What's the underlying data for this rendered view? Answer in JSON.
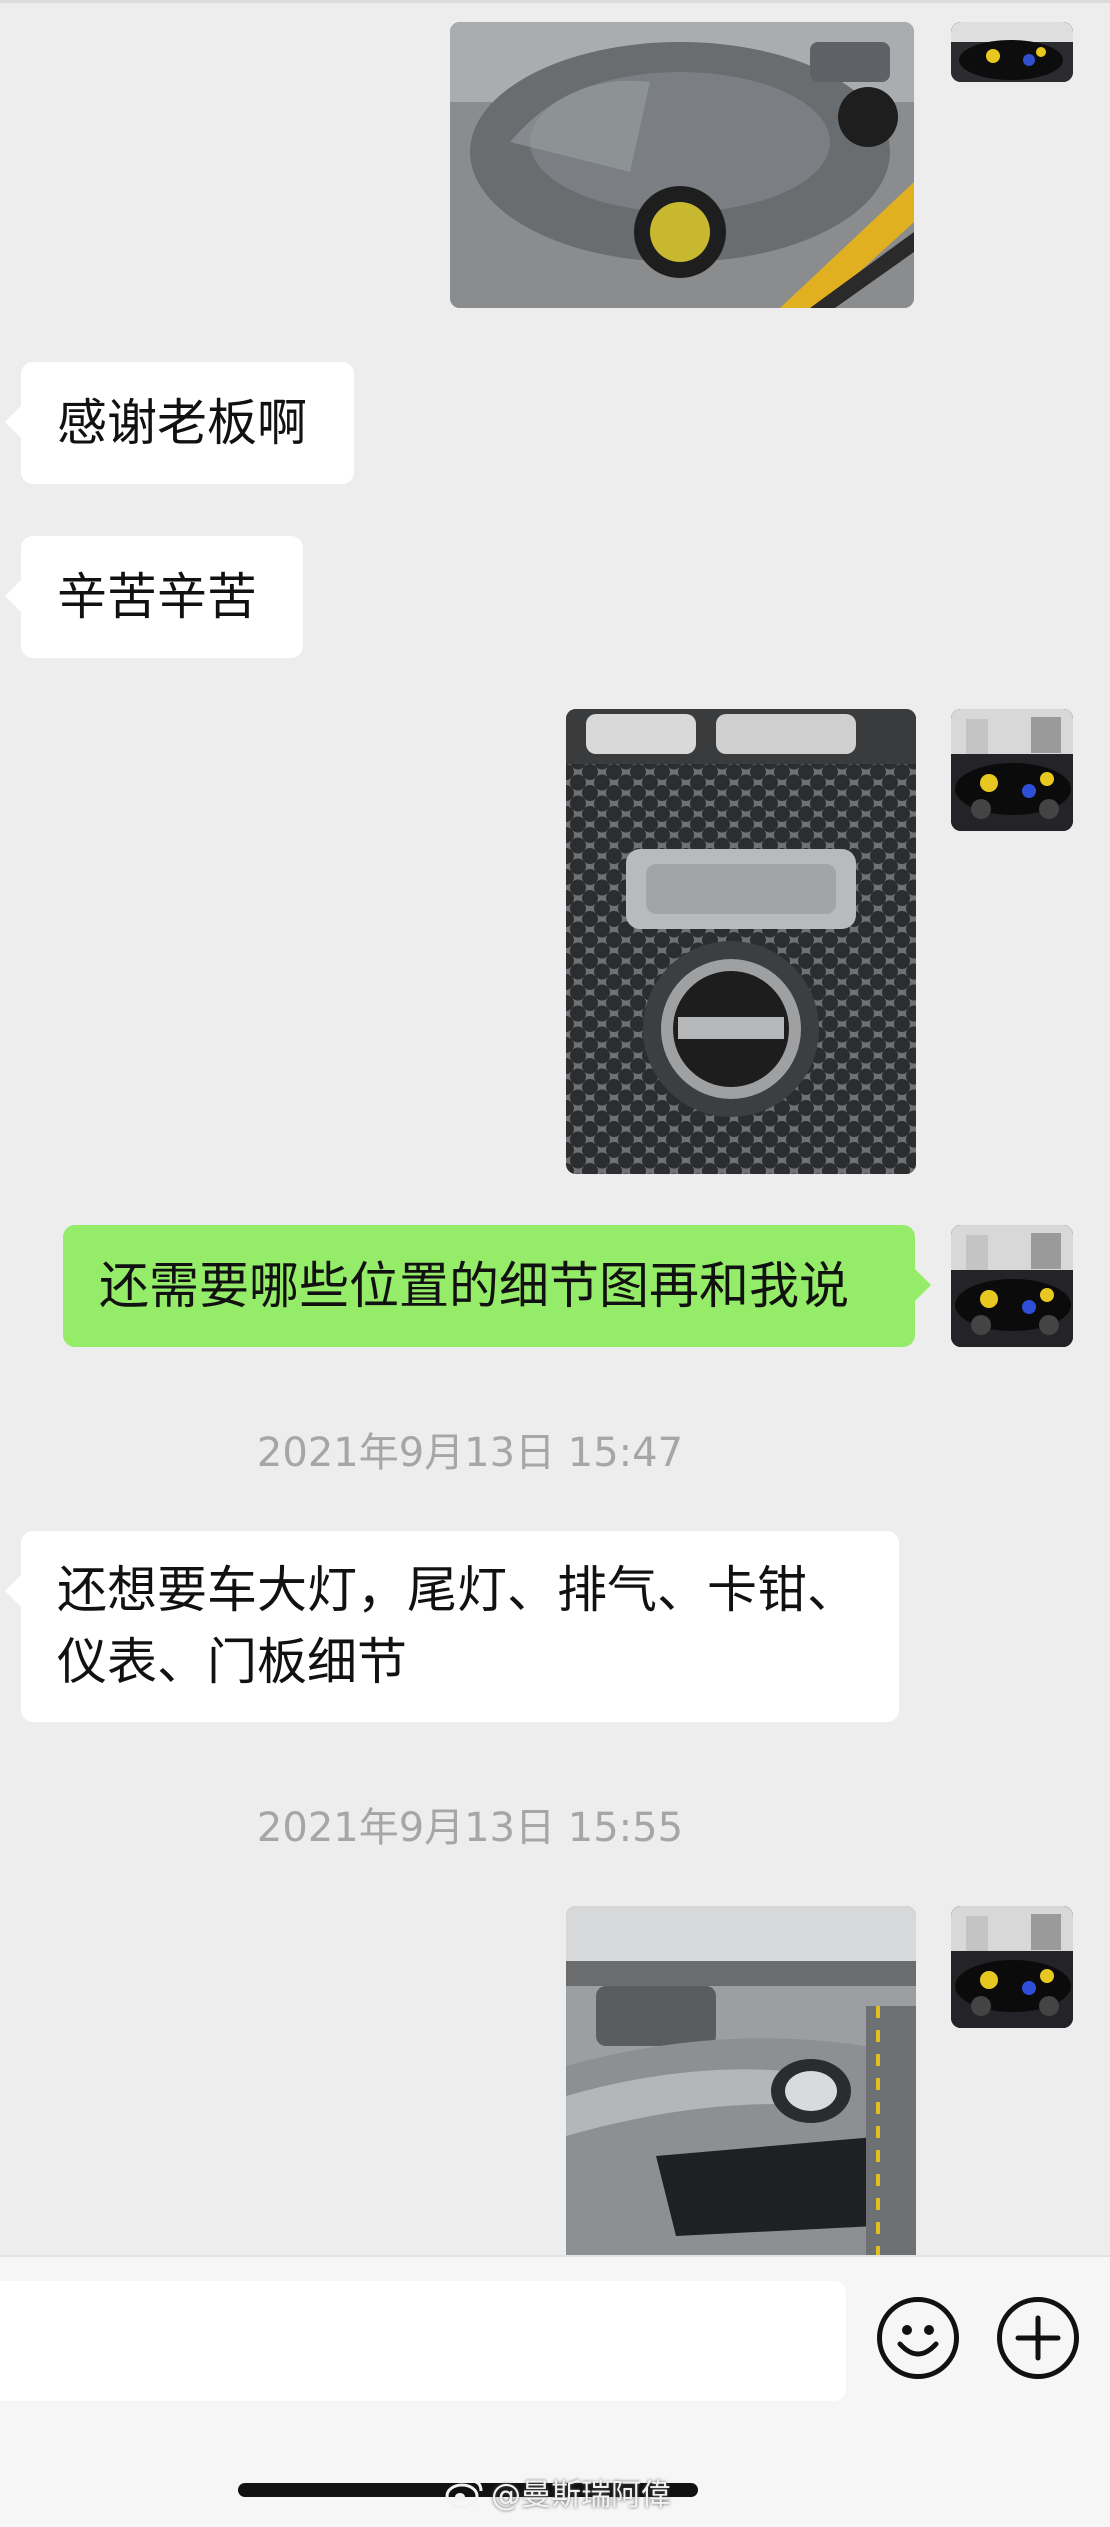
{
  "messages": {
    "left_thanks": "感谢老板啊",
    "left_hard_work": "辛苦辛苦",
    "right_request": "还需要哪些位置的细节图再和我说",
    "left_detail_line1": "还想要车大灯，尾灯、排气、卡钳、",
    "left_detail_line2": "仪表、门板细节"
  },
  "timestamps": {
    "first": "2021年9月13日 15:47",
    "second": "2021年9月13日 15:55"
  },
  "input_bar": {
    "placeholder": "",
    "emoji_icon": "smile-emoji-icon",
    "plus_icon": "plus-circle-icon"
  },
  "watermark": {
    "text": "@曼斯瑞阿偉",
    "icon": "weibo-logo-icon"
  },
  "colors": {
    "background": "#ededed",
    "incoming_bubble": "#ffffff",
    "outgoing_bubble": "#95ec69",
    "timestamp_text": "#a6a6a6"
  }
}
